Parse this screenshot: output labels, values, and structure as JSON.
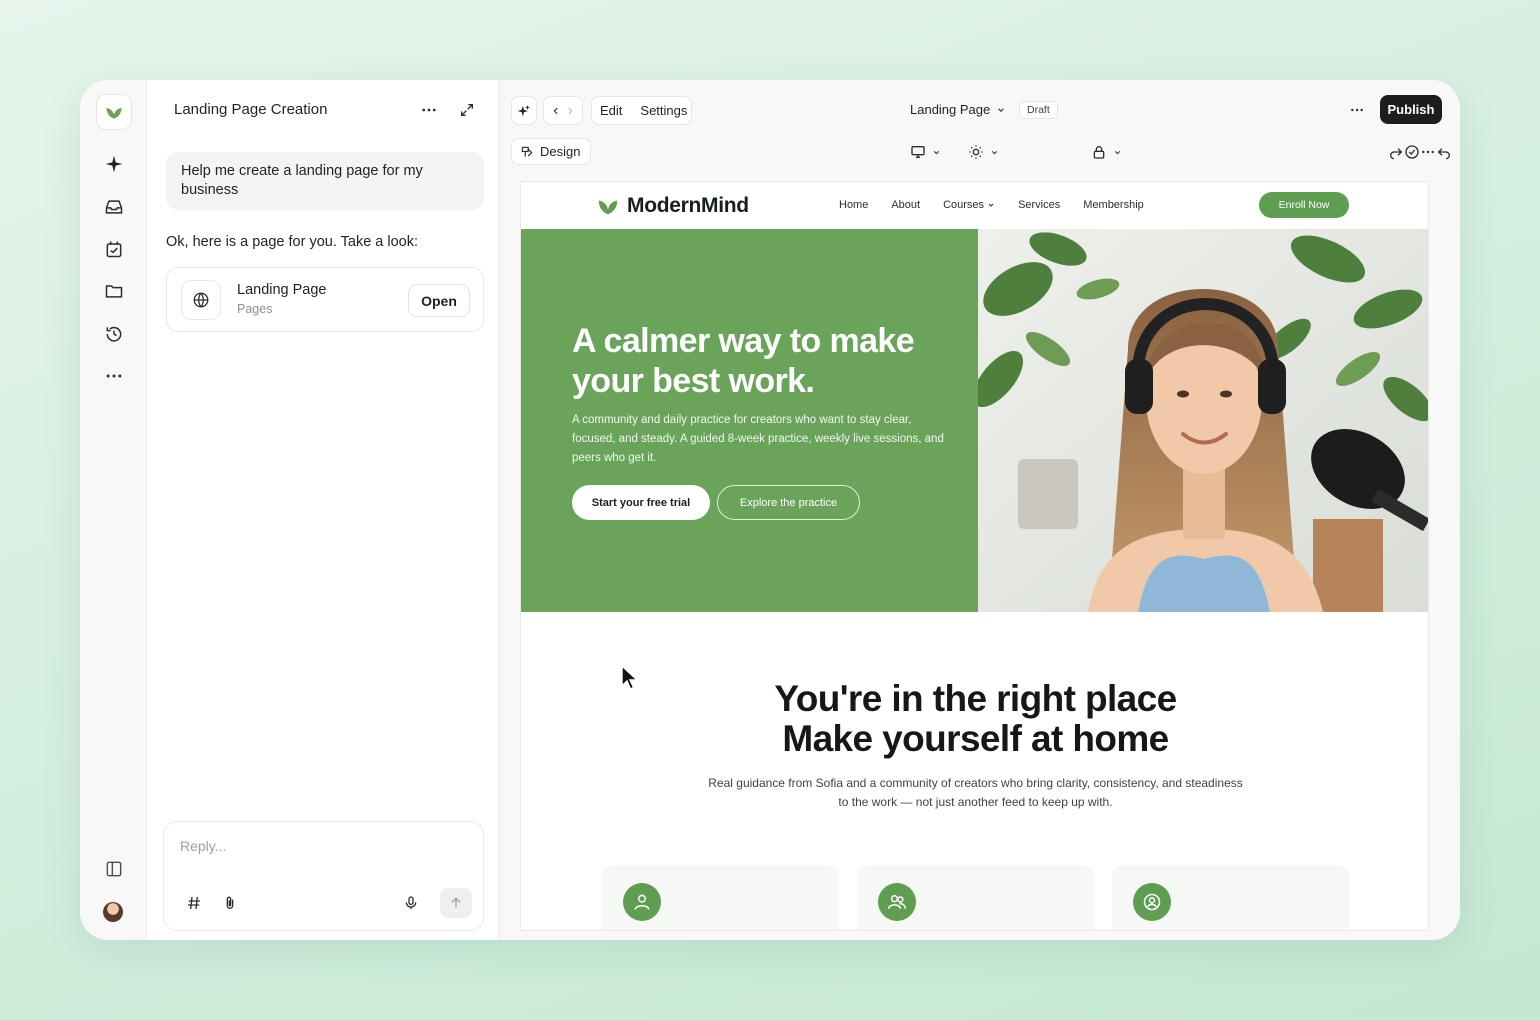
{
  "chat": {
    "title": "Landing Page Creation",
    "user_message": "Help me create a landing page for my business",
    "assistant_message": "Ok, here is a page for you. Take a look:",
    "card": {
      "title": "Landing Page",
      "subtitle": "Pages",
      "open_label": "Open"
    },
    "composer_placeholder": "Reply..."
  },
  "editor": {
    "edit_label": "Edit",
    "settings_label": "Settings",
    "page_name": "Landing Page",
    "status_badge": "Draft",
    "publish_label": "Publish",
    "design_label": "Design"
  },
  "site": {
    "brand": "ModernMind",
    "nav": {
      "home": "Home",
      "about": "About",
      "courses": "Courses",
      "services": "Services",
      "membership": "Membership"
    },
    "enroll_label": "Enroll Now",
    "hero": {
      "title": "A calmer way to make your best work.",
      "subtitle": "A community and daily practice for creators who want to stay clear, focused, and steady. A guided 8-week practice, weekly live sessions, and peers who get it.",
      "primary_cta": "Start your free trial",
      "secondary_cta": "Explore the practice"
    },
    "section2": {
      "title_line1": "You're in the right place",
      "title_line2": "Make yourself at home",
      "subtitle": "Real guidance from Sofia and a community of creators who bring clarity, consistency, and steadiness to the work — not just another feed to keep up with."
    }
  },
  "colors": {
    "accent": "#6aa45b",
    "button_green": "#5f9d51",
    "publish_bg": "#1b1e1c"
  }
}
